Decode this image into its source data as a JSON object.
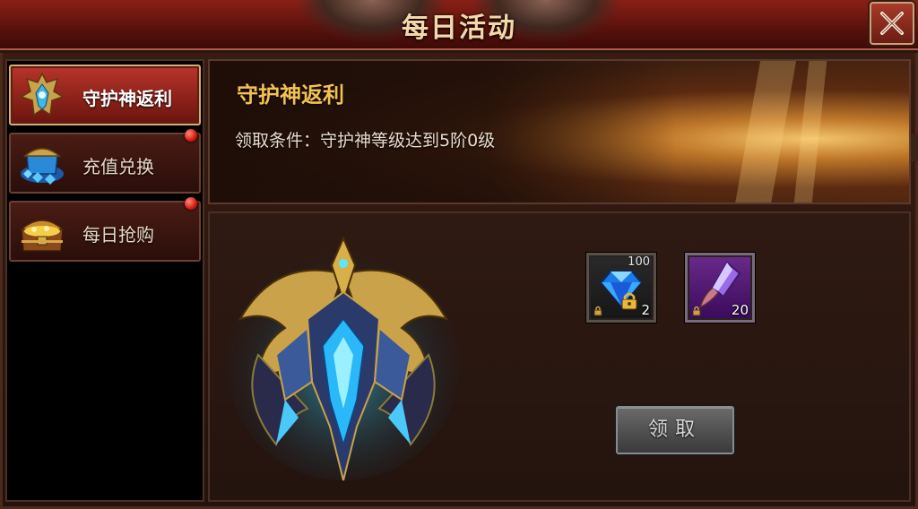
{
  "header": {
    "title": "每日活动"
  },
  "sidebar": {
    "items": [
      {
        "label": "守护神返利",
        "icon": "guardian-armor-icon",
        "active": true,
        "badge": false
      },
      {
        "label": "充值兑换",
        "icon": "treasure-gems-icon",
        "active": false,
        "badge": true
      },
      {
        "label": "每日抢购",
        "icon": "treasure-chest-icon",
        "active": false,
        "badge": true
      }
    ]
  },
  "banner": {
    "title": "守护神返利",
    "condition": "领取条件：守护神等级达到5阶0级"
  },
  "rewards": [
    {
      "icon": "blue-diamond-icon",
      "top_label": "100",
      "count": "2",
      "locked": true
    },
    {
      "icon": "purple-crystal-icon",
      "top_label": "",
      "count": "20",
      "locked": true
    }
  ],
  "claim_button": {
    "label": "领取"
  },
  "colors": {
    "header_red": "#8a2016",
    "active_tab": "#b8342a",
    "title_gold": "#f2c250",
    "badge_red": "#d41a10"
  }
}
